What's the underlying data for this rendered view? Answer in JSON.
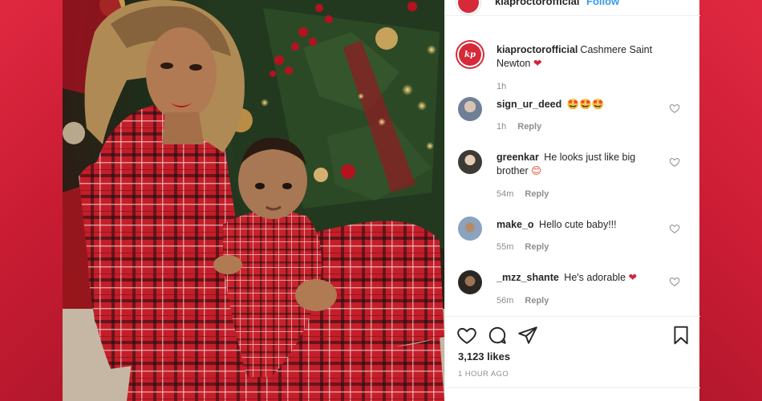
{
  "post": {
    "top_handle": "kiaproctorofficial",
    "top_follow": "Follow",
    "author": "kiaproctorofficial",
    "avatar_text": "kp",
    "caption": "Cashmere Saint Newton",
    "caption_time": "1h",
    "likes": "3,123 likes",
    "time_ago": "1 HOUR AGO"
  },
  "comments": [
    {
      "user": "sign_ur_deed",
      "text": "🤩🤩🤩",
      "time": "1h",
      "reply": "Reply"
    },
    {
      "user": "greenkar",
      "text": "He looks just like big brother",
      "emoji": "😊",
      "time": "54m",
      "reply": "Reply"
    },
    {
      "user": "make_o",
      "text": "Hello cute baby!!!",
      "time": "55m",
      "reply": "Reply"
    },
    {
      "user": "_mzz_shante",
      "text": "He's adorable",
      "time": "56m",
      "reply": "Reply"
    }
  ],
  "icons": {
    "like": "heart-outline-icon",
    "comment": "comment-bubble-icon",
    "share": "paper-plane-icon",
    "save": "bookmark-icon"
  },
  "colors": {
    "background": "#d2203a",
    "link_blue": "#3897f0",
    "brand_red": "#d62a3a",
    "plaid_red": "#c41e2a"
  }
}
